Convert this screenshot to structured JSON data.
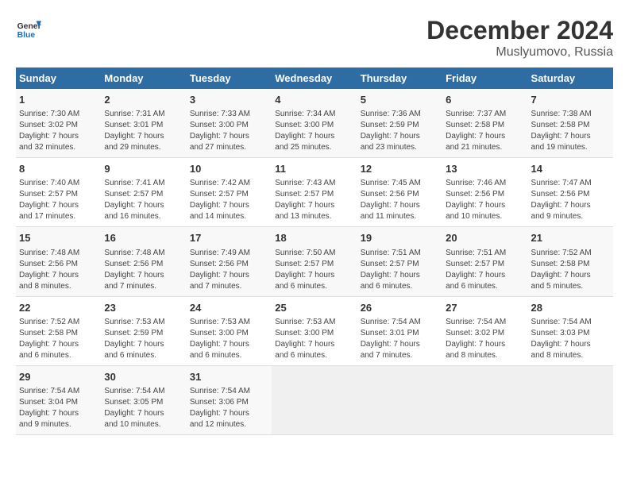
{
  "header": {
    "logo_line1": "General",
    "logo_line2": "Blue",
    "main_title": "December 2024",
    "subtitle": "Muslyumovo, Russia"
  },
  "weekdays": [
    "Sunday",
    "Monday",
    "Tuesday",
    "Wednesday",
    "Thursday",
    "Friday",
    "Saturday"
  ],
  "weeks": [
    [
      {
        "day": "1",
        "lines": [
          "Sunrise: 7:30 AM",
          "Sunset: 3:02 PM",
          "Daylight: 7 hours",
          "and 32 minutes."
        ]
      },
      {
        "day": "2",
        "lines": [
          "Sunrise: 7:31 AM",
          "Sunset: 3:01 PM",
          "Daylight: 7 hours",
          "and 29 minutes."
        ]
      },
      {
        "day": "3",
        "lines": [
          "Sunrise: 7:33 AM",
          "Sunset: 3:00 PM",
          "Daylight: 7 hours",
          "and 27 minutes."
        ]
      },
      {
        "day": "4",
        "lines": [
          "Sunrise: 7:34 AM",
          "Sunset: 3:00 PM",
          "Daylight: 7 hours",
          "and 25 minutes."
        ]
      },
      {
        "day": "5",
        "lines": [
          "Sunrise: 7:36 AM",
          "Sunset: 2:59 PM",
          "Daylight: 7 hours",
          "and 23 minutes."
        ]
      },
      {
        "day": "6",
        "lines": [
          "Sunrise: 7:37 AM",
          "Sunset: 2:58 PM",
          "Daylight: 7 hours",
          "and 21 minutes."
        ]
      },
      {
        "day": "7",
        "lines": [
          "Sunrise: 7:38 AM",
          "Sunset: 2:58 PM",
          "Daylight: 7 hours",
          "and 19 minutes."
        ]
      }
    ],
    [
      {
        "day": "8",
        "lines": [
          "Sunrise: 7:40 AM",
          "Sunset: 2:57 PM",
          "Daylight: 7 hours",
          "and 17 minutes."
        ]
      },
      {
        "day": "9",
        "lines": [
          "Sunrise: 7:41 AM",
          "Sunset: 2:57 PM",
          "Daylight: 7 hours",
          "and 16 minutes."
        ]
      },
      {
        "day": "10",
        "lines": [
          "Sunrise: 7:42 AM",
          "Sunset: 2:57 PM",
          "Daylight: 7 hours",
          "and 14 minutes."
        ]
      },
      {
        "day": "11",
        "lines": [
          "Sunrise: 7:43 AM",
          "Sunset: 2:57 PM",
          "Daylight: 7 hours",
          "and 13 minutes."
        ]
      },
      {
        "day": "12",
        "lines": [
          "Sunrise: 7:45 AM",
          "Sunset: 2:56 PM",
          "Daylight: 7 hours",
          "and 11 minutes."
        ]
      },
      {
        "day": "13",
        "lines": [
          "Sunrise: 7:46 AM",
          "Sunset: 2:56 PM",
          "Daylight: 7 hours",
          "and 10 minutes."
        ]
      },
      {
        "day": "14",
        "lines": [
          "Sunrise: 7:47 AM",
          "Sunset: 2:56 PM",
          "Daylight: 7 hours",
          "and 9 minutes."
        ]
      }
    ],
    [
      {
        "day": "15",
        "lines": [
          "Sunrise: 7:48 AM",
          "Sunset: 2:56 PM",
          "Daylight: 7 hours",
          "and 8 minutes."
        ]
      },
      {
        "day": "16",
        "lines": [
          "Sunrise: 7:48 AM",
          "Sunset: 2:56 PM",
          "Daylight: 7 hours",
          "and 7 minutes."
        ]
      },
      {
        "day": "17",
        "lines": [
          "Sunrise: 7:49 AM",
          "Sunset: 2:56 PM",
          "Daylight: 7 hours",
          "and 7 minutes."
        ]
      },
      {
        "day": "18",
        "lines": [
          "Sunrise: 7:50 AM",
          "Sunset: 2:57 PM",
          "Daylight: 7 hours",
          "and 6 minutes."
        ]
      },
      {
        "day": "19",
        "lines": [
          "Sunrise: 7:51 AM",
          "Sunset: 2:57 PM",
          "Daylight: 7 hours",
          "and 6 minutes."
        ]
      },
      {
        "day": "20",
        "lines": [
          "Sunrise: 7:51 AM",
          "Sunset: 2:57 PM",
          "Daylight: 7 hours",
          "and 6 minutes."
        ]
      },
      {
        "day": "21",
        "lines": [
          "Sunrise: 7:52 AM",
          "Sunset: 2:58 PM",
          "Daylight: 7 hours",
          "and 5 minutes."
        ]
      }
    ],
    [
      {
        "day": "22",
        "lines": [
          "Sunrise: 7:52 AM",
          "Sunset: 2:58 PM",
          "Daylight: 7 hours",
          "and 6 minutes."
        ]
      },
      {
        "day": "23",
        "lines": [
          "Sunrise: 7:53 AM",
          "Sunset: 2:59 PM",
          "Daylight: 7 hours",
          "and 6 minutes."
        ]
      },
      {
        "day": "24",
        "lines": [
          "Sunrise: 7:53 AM",
          "Sunset: 3:00 PM",
          "Daylight: 7 hours",
          "and 6 minutes."
        ]
      },
      {
        "day": "25",
        "lines": [
          "Sunrise: 7:53 AM",
          "Sunset: 3:00 PM",
          "Daylight: 7 hours",
          "and 6 minutes."
        ]
      },
      {
        "day": "26",
        "lines": [
          "Sunrise: 7:54 AM",
          "Sunset: 3:01 PM",
          "Daylight: 7 hours",
          "and 7 minutes."
        ]
      },
      {
        "day": "27",
        "lines": [
          "Sunrise: 7:54 AM",
          "Sunset: 3:02 PM",
          "Daylight: 7 hours",
          "and 8 minutes."
        ]
      },
      {
        "day": "28",
        "lines": [
          "Sunrise: 7:54 AM",
          "Sunset: 3:03 PM",
          "Daylight: 7 hours",
          "and 8 minutes."
        ]
      }
    ],
    [
      {
        "day": "29",
        "lines": [
          "Sunrise: 7:54 AM",
          "Sunset: 3:04 PM",
          "Daylight: 7 hours",
          "and 9 minutes."
        ]
      },
      {
        "day": "30",
        "lines": [
          "Sunrise: 7:54 AM",
          "Sunset: 3:05 PM",
          "Daylight: 7 hours",
          "and 10 minutes."
        ]
      },
      {
        "day": "31",
        "lines": [
          "Sunrise: 7:54 AM",
          "Sunset: 3:06 PM",
          "Daylight: 7 hours",
          "and 12 minutes."
        ]
      },
      null,
      null,
      null,
      null
    ]
  ]
}
